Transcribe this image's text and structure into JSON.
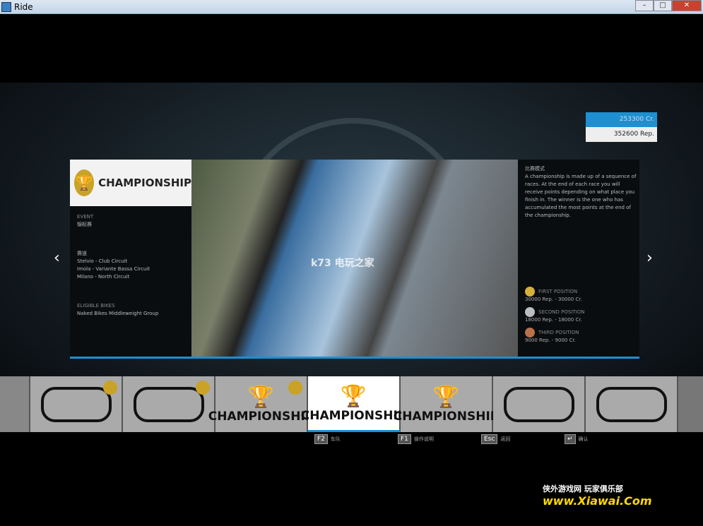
{
  "window": {
    "title": "Ride",
    "buttons": [
      "–",
      "□",
      "✕"
    ]
  },
  "currency": {
    "credits": "253300 Cr.",
    "rep": "352600 Rep."
  },
  "panel": {
    "logo_text": "CHAMPIONSHIP",
    "event_label": "EVENT",
    "event_value": "锦标赛",
    "tracks_label": "赛道",
    "tracks": [
      "Stelvio - Club Circuit",
      "Imola - Variante Bassa Circuit",
      "Milano - North Circuit"
    ],
    "bikes_label": "ELIGIBLE BIKES",
    "bikes_value": "Naked Bikes Middleweight Group",
    "desc_label": "比赛模式",
    "description": "A championship is made up of a sequence of races. At the end of each race you will receive points depending on what place you finish in. The winner is the one who has accumulated the most points at the end of the championship.",
    "positions": [
      {
        "label": "FIRST POSITION",
        "reward": "30000 Rep. - 30000 Cr.",
        "color": "#d4b13a"
      },
      {
        "label": "SECOND POSITION",
        "reward": "18000 Rep. - 18000 Cr.",
        "color": "#bdbdbd"
      },
      {
        "label": "THIRD POSITION",
        "reward": "9000 Rep. - 9000 Cr.",
        "color": "#b8724a"
      }
    ],
    "watermark": "k73 电玩之家"
  },
  "carousel": [
    {
      "type": "track",
      "completed": true
    },
    {
      "type": "track",
      "completed": true
    },
    {
      "type": "championship",
      "label": "CHAMPIONSHIP",
      "completed": true
    },
    {
      "type": "championship",
      "label": "CHAMPIONSHIP",
      "selected": true
    },
    {
      "type": "championship",
      "label": "CHAMPIONSHIP"
    },
    {
      "type": "track"
    },
    {
      "type": "track"
    }
  ],
  "hints": [
    {
      "key": "F2",
      "label": "车队"
    },
    {
      "key": "F1",
      "label": "操作说明"
    },
    {
      "key": "Esc",
      "label": "返回"
    },
    {
      "key": "↵",
      "label": "确认"
    }
  ],
  "site": {
    "top": "侠外游戏网 玩家俱乐部",
    "main": "www.Xiawai.Com"
  }
}
